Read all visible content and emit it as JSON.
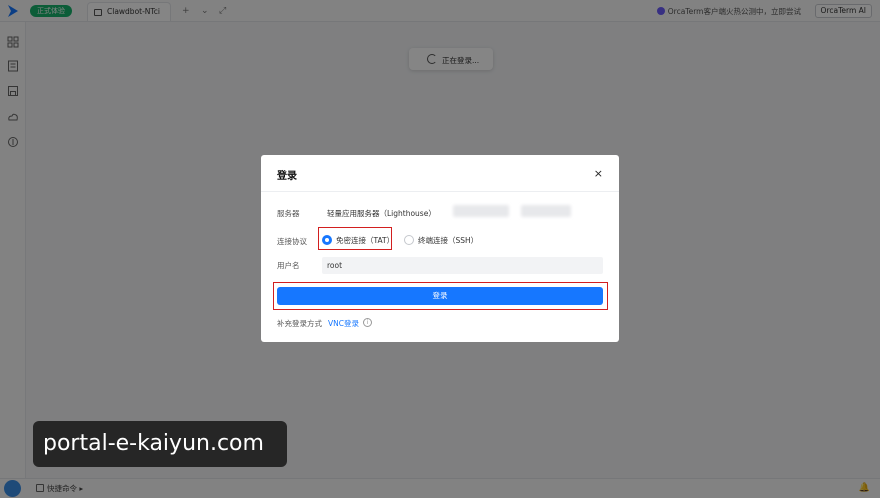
{
  "topbar": {
    "env_badge": "正式体验",
    "tab_label": "Clawdbot-NTci",
    "promo_text": "OrcaTerm客户端火热公测中，立即尝试",
    "ai_button": "OrcaTerm AI"
  },
  "loading": {
    "text": "正在登录..."
  },
  "dialog": {
    "title": "登录",
    "close": "×",
    "server_label": "服务器",
    "server_value": "轻量应用服务器（Lighthouse）",
    "protocol_label": "连接协议",
    "protocol_options": [
      "免密连接（TAT）",
      "终端连接（SSH）"
    ],
    "selected_protocol": "免密连接（TAT）",
    "username_label": "用户名",
    "username_value": "root",
    "login_button": "登录",
    "extra_label": "补充登录方式",
    "vnc_link": "VNC登录"
  },
  "bottombar": {
    "command_label": "快捷命令"
  },
  "watermark": {
    "text": "portal-e-kaiyun.com"
  },
  "colors": {
    "primary": "#1677ff",
    "badge_green": "#18b26b",
    "highlight_red": "#d21f1f"
  }
}
